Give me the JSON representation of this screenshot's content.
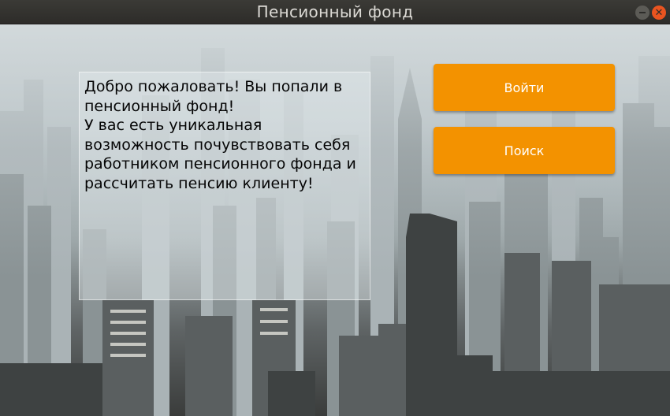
{
  "window": {
    "title": "Пенсионный фонд"
  },
  "welcome": {
    "text": "Добро пожаловать! Вы попали в пенсионный фонд!\nУ вас есть уникальная возможность почувствовать себя работником пенсионного фонда и рассчитать пенсию клиенту!"
  },
  "buttons": {
    "login_label": "Войти",
    "search_label": "Поиск"
  },
  "colors": {
    "button_bg": "#f39200",
    "button_text": "#ffffff",
    "close_button": "#e95420",
    "titlebar": "#2d2c29"
  }
}
